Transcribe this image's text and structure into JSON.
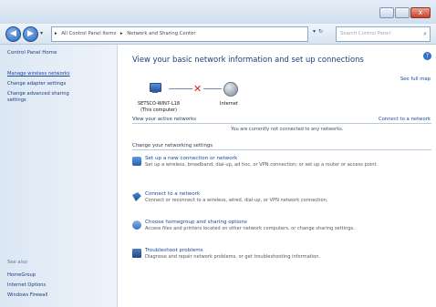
{
  "window": {
    "controls": {
      "minimize": "",
      "maximize": "",
      "close": "x"
    }
  },
  "nav": {
    "back_icon": "back-arrow-icon",
    "forward_icon": "forward-arrow-icon",
    "dropdown": "▾",
    "breadcrumb": [
      "All Control Panel Items",
      "Network and Sharing Center"
    ],
    "refresh": "↻",
    "search_placeholder": "Search Control Panel"
  },
  "sidebar": {
    "home": "Control Panel Home",
    "links": [
      "Manage wireless networks",
      "Change adapter settings",
      "Change advanced sharing settings"
    ],
    "see_also_label": "See also",
    "see_also": [
      "HomeGroup",
      "Internet Options",
      "Windows Firewall"
    ]
  },
  "main": {
    "title": "View your basic network information and set up connections",
    "see_full_map": "See full map",
    "map": {
      "computer_name": "SETSCO-WIN7-L18",
      "computer_sub": "(This computer)",
      "internet": "Internet",
      "status_icon": "red-x-icon"
    },
    "active_networks_label": "View your active networks",
    "connect_to_network": "Connect to a network",
    "not_connected": "You are currently not connected to any networks.",
    "change_settings_label": "Change your networking settings",
    "tasks": [
      {
        "link": "Set up a new connection or network",
        "desc": "Set up a wireless, broadband, dial-up, ad hoc, or VPN connection; or set up a router or access point."
      },
      {
        "link": "Connect to a network",
        "desc": "Connect or reconnect to a wireless, wired, dial-up, or VPN network connection."
      },
      {
        "link": "Choose homegroup and sharing options",
        "desc": "Access files and printers located on other network computers, or change sharing settings."
      },
      {
        "link": "Troubleshoot problems",
        "desc": "Diagnose and repair network problems, or get troubleshooting information."
      }
    ]
  }
}
